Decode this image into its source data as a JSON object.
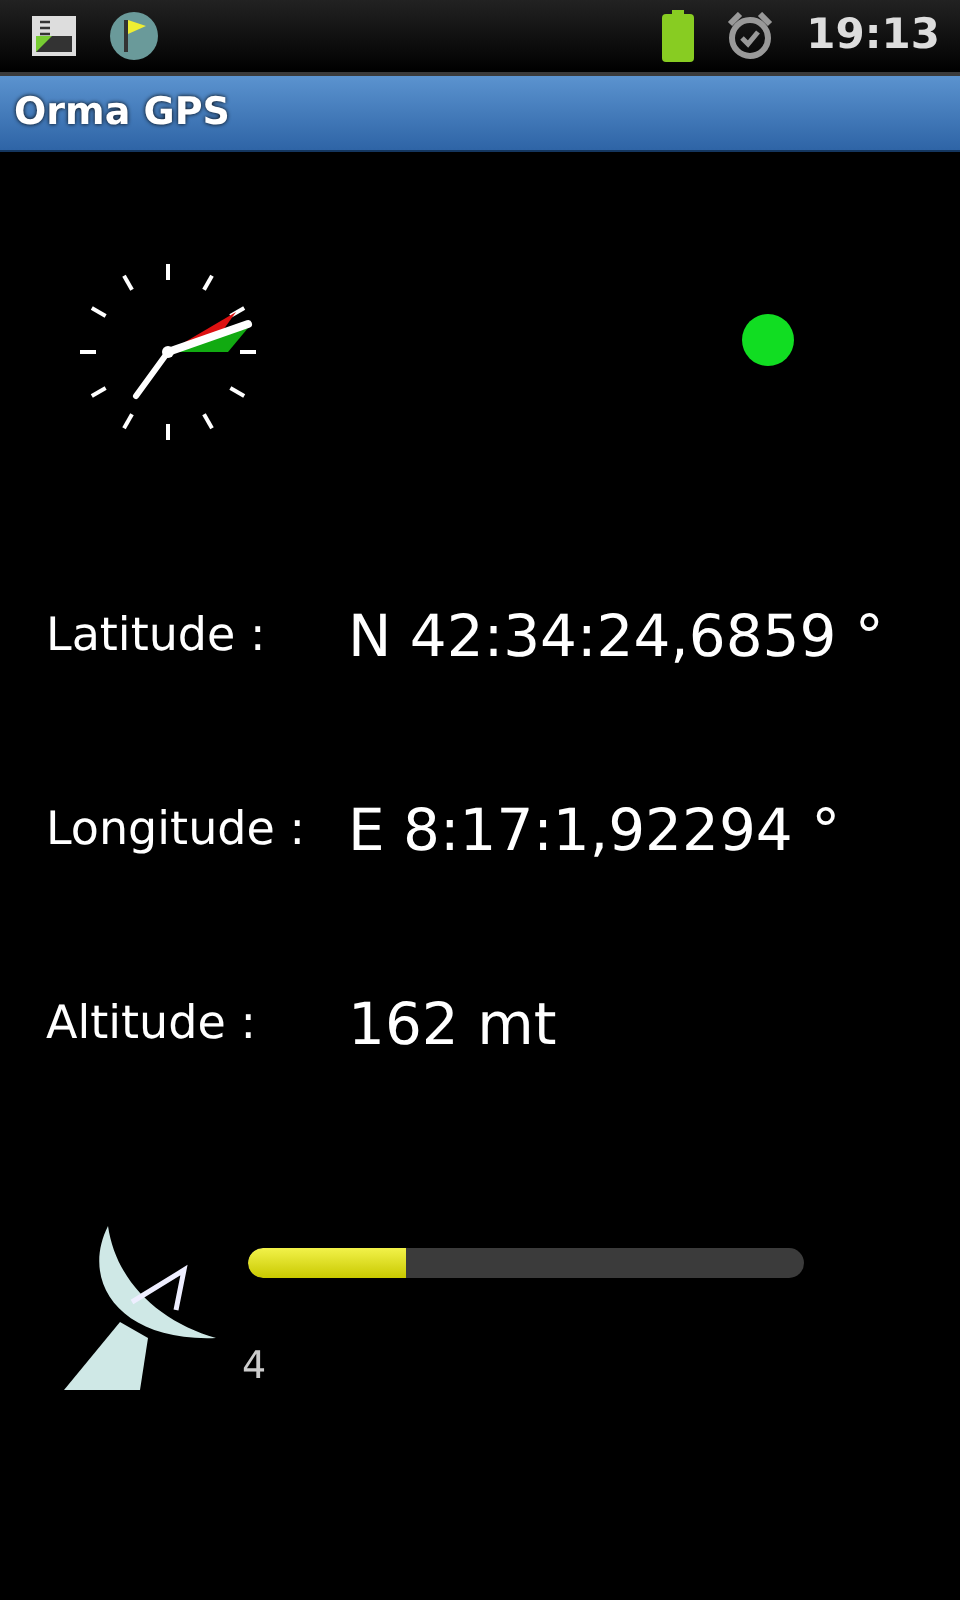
{
  "status_bar": {
    "time": "19:13"
  },
  "window": {
    "title": "Orma GPS"
  },
  "readings": [
    {
      "label": "Latitude :",
      "value": "N 42:34:24,6859 °"
    },
    {
      "label": "Longitude :",
      "value": "E 8:17:1,92294 °"
    },
    {
      "label": "Altitude :",
      "value": "162 mt"
    }
  ],
  "satellites": {
    "count": "4",
    "level": 0.285
  }
}
